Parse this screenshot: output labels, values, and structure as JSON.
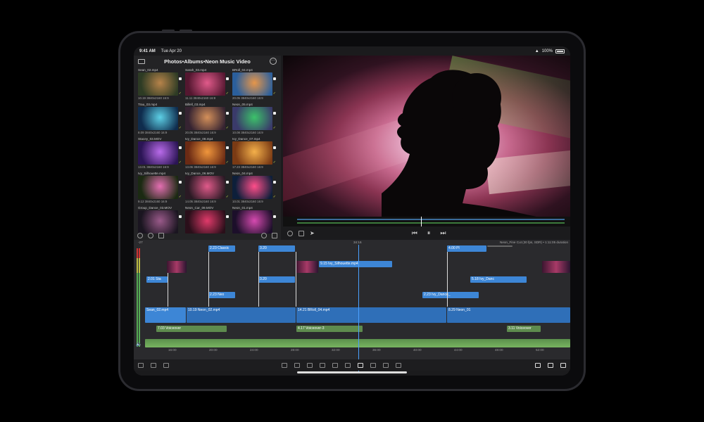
{
  "status_bar": {
    "time": "9:41 AM",
    "date": "Tue Apr 20",
    "battery": "100%"
  },
  "browser": {
    "breadcrumb": "Photos•Albums•Neon Music Video",
    "clips": [
      {
        "name": "Sean_02.mp4",
        "meta": "10.19  3840x2160  16:9",
        "colors": [
          "#2d3b24",
          "#b6834a"
        ]
      },
      {
        "name": "Sarah_03.mp4",
        "meta": "11.11  3840x2160  16:9",
        "colors": [
          "#541730",
          "#e05a8a"
        ]
      },
      {
        "name": "BRoll_04.mp4",
        "meta": "20.05  3840x2160  16:9",
        "colors": [
          "#2b5f9c",
          "#e6964a"
        ]
      },
      {
        "name": "Trau_03.mp4",
        "meta": "8.09  3840x2160  16:9",
        "colors": [
          "#0f2c4d",
          "#5dd0e6"
        ]
      },
      {
        "name": "Billell_03.mp4",
        "meta": "20.05  3840x2160  16:9",
        "colors": [
          "#352331",
          "#d4905a"
        ]
      },
      {
        "name": "Neon_05.mp4",
        "meta": "10.08  3840x2160  16:9",
        "colors": [
          "#3a3a6a",
          "#3cc26a"
        ]
      },
      {
        "name": "Stacey_03.MOV",
        "meta": "13.01  3840x2160  16:9",
        "colors": [
          "#2b1555",
          "#b96bea"
        ]
      },
      {
        "name": "Ivy_Dance_08.mp4",
        "meta": "13.06  3840x2160  16:9",
        "colors": [
          "#6a2a14",
          "#f0963c"
        ]
      },
      {
        "name": "Ivy_Dance_07.mp4",
        "meta": "17.23  3840x2160  16:9",
        "colors": [
          "#7a3a14",
          "#f4b04a"
        ]
      },
      {
        "name": "Ivy_Silhouette.mp4",
        "meta": "9.12  3840x2160  16:9",
        "colors": [
          "#1b2a12",
          "#e46fb2"
        ]
      },
      {
        "name": "Ivy_Dance_06.MOV",
        "meta": "14.05  3840x2160  16:9",
        "colors": [
          "#2a1a24",
          "#e05a8a"
        ]
      },
      {
        "name": "Neon_04.mp4",
        "meta": "10.01  3840x2160  16:9",
        "colors": [
          "#0d1f3a",
          "#ff4e8a"
        ]
      },
      {
        "name": "Group_Dance_03.MOV",
        "meta": "",
        "colors": [
          "#1a1520",
          "#9a5a8a"
        ]
      },
      {
        "name": "Neon_Car_09.MOV",
        "meta": "",
        "colors": [
          "#2a0f1a",
          "#e03a6a"
        ]
      },
      {
        "name": "Neon_01.mp4",
        "meta": "",
        "colors": [
          "#1c0f2a",
          "#d64ab0"
        ]
      }
    ]
  },
  "timeline": {
    "left_value": "-27",
    "playhead_time": "34:16",
    "project_info": "Neon_Fine Cut (30 fps, SDR) • 1:11:05 duration",
    "ruler": [
      "16:00",
      "20:00",
      "24:00",
      "28:00",
      "32:00",
      "36:00",
      "40:00",
      "44:00",
      "48:00",
      "52:00"
    ],
    "clips": {
      "c1": "2.23  Classic",
      "c2": "3.20",
      "c3": "4.00  Pl",
      "c4": "2.01  Sta",
      "c5": "9.15  Ivy_Silhouette.mp4",
      "c6": "5.18  Ivy_Danc",
      "c7": "2.23  Ivy_Dance_",
      "c8": "2.23  Neo",
      "c9": "Sean_02.mp4",
      "c10": "10.19  Neon_02.mp4",
      "c11": "14.21  BRoll_04.mp4",
      "c12": "8.29  Neon_01",
      "c13": "7.03  Voiceover",
      "c14": "4.17  Voiceover-3",
      "c15": "3.11  Voiceover",
      "c16": "3.20"
    }
  }
}
